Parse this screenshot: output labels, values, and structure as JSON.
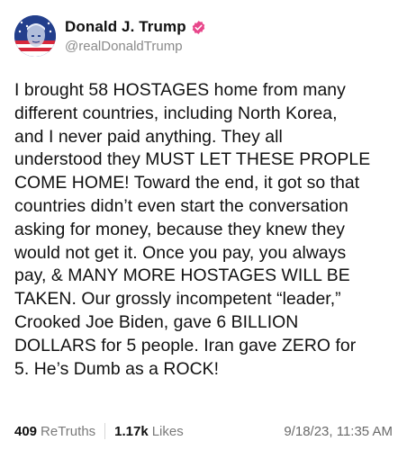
{
  "account": {
    "display_name": "Donald J. Trump",
    "handle": "@realDonaldTrump",
    "verified_icon": "verified-badge-icon",
    "verified_color": "#e8478b"
  },
  "post": {
    "text": "I brought 58 HOSTAGES home from many\ndifferent countries, including North Korea,\nand I never paid anything. They all\nunderstood they MUST LET THESE PROPLE\nCOME HOME! Toward the end, it got so that\ncountries didn’t even start the conversation\nasking for money, because they knew they\nwould not get it. Once you pay, you always\npay, & MANY MORE HOSTAGES WILL BE\nTAKEN. Our grossly incompetent “leader,”\nCrooked Joe Biden, gave 6 BILLION\nDOLLARS for 5 people. Iran gave ZERO for\n5. He’s Dumb as a ROCK!"
  },
  "stats": {
    "retruths_count": "409",
    "retruths_label": "ReTruths",
    "likes_count": "1.17k",
    "likes_label": "Likes",
    "timestamp": "9/18/23, 11:35 AM"
  }
}
